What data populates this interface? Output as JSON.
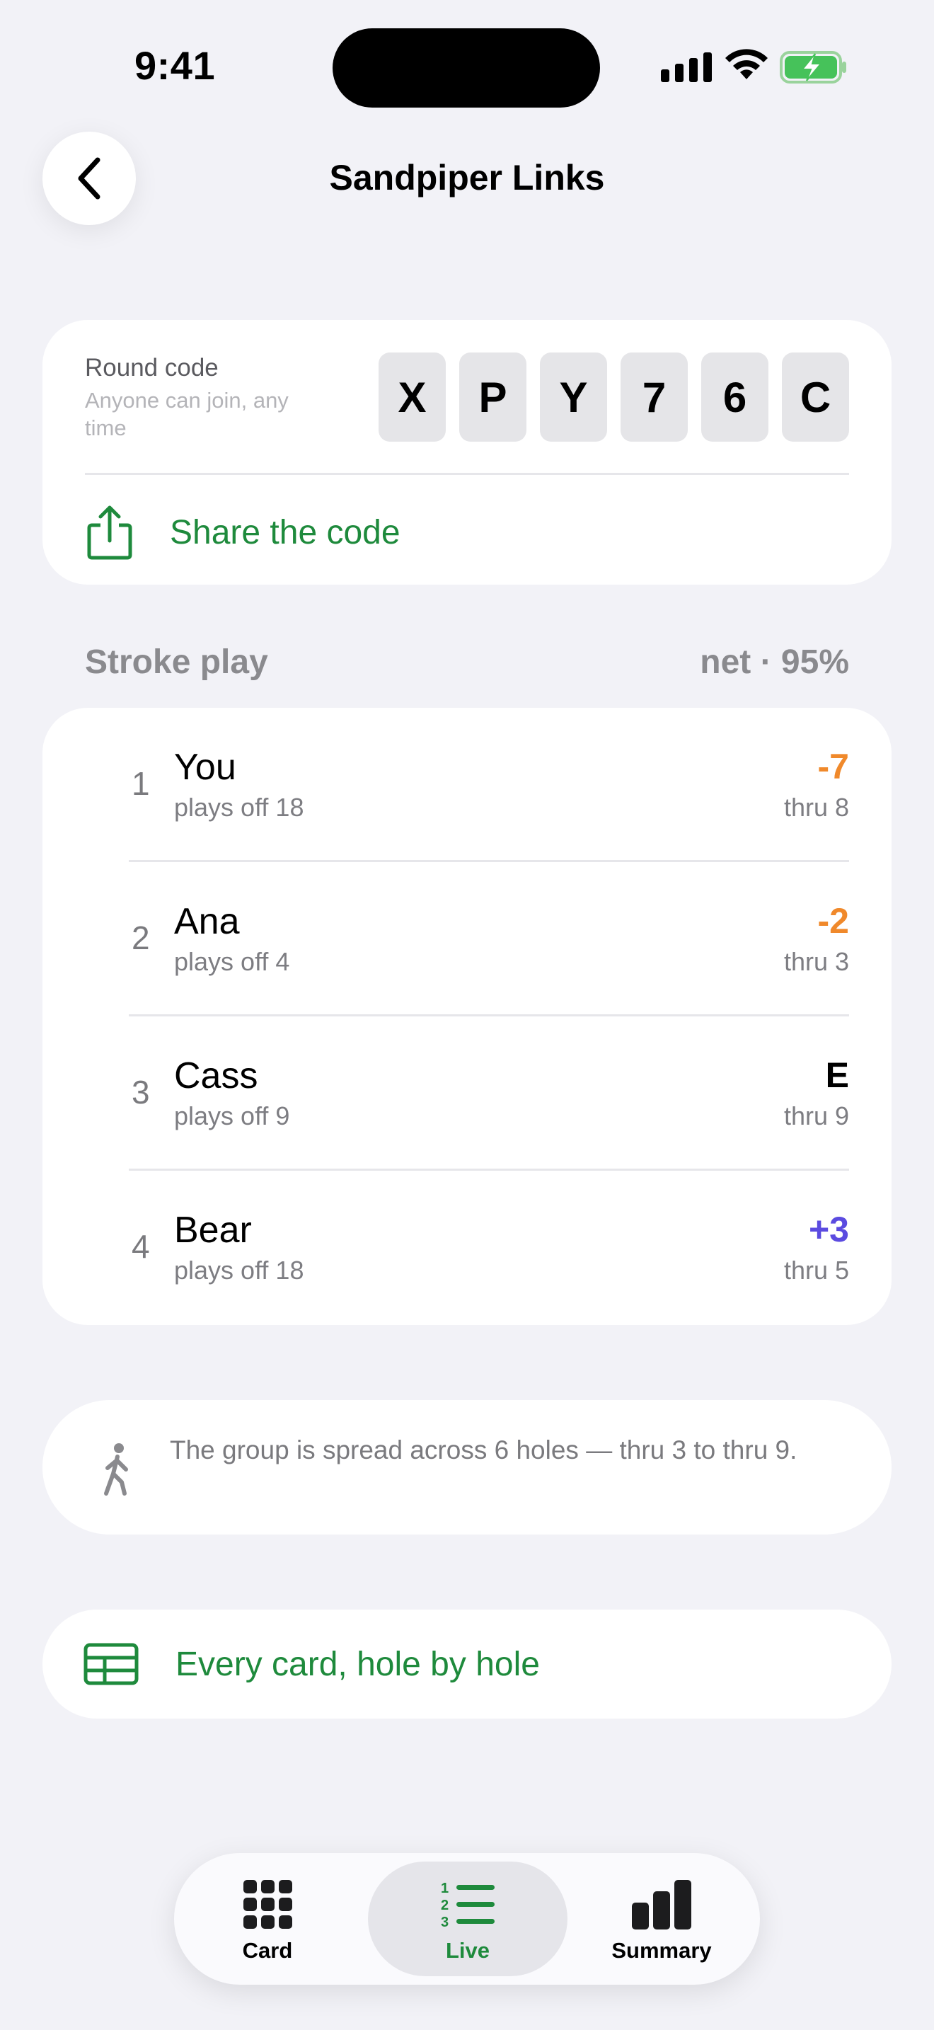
{
  "status_bar": {
    "time": "9:41"
  },
  "nav": {
    "title": "Sandpiper Links"
  },
  "round_code": {
    "label": "Round code",
    "sublabel": "Anyone can join, any time",
    "characters": [
      "X",
      "P",
      "Y",
      "7",
      "6",
      "C"
    ],
    "share_label": "Share the code"
  },
  "leaderboard": {
    "format": "Stroke play",
    "scoring": "net · 95%",
    "players": [
      {
        "rank": "1",
        "name": "You",
        "handicap": "plays off 18",
        "score": "-7",
        "thru": "thru 8",
        "score_color": "#f0892b"
      },
      {
        "rank": "2",
        "name": "Ana",
        "handicap": "plays off 4",
        "score": "-2",
        "thru": "thru 3",
        "score_color": "#f0892b"
      },
      {
        "rank": "3",
        "name": "Cass",
        "handicap": "plays off 9",
        "score": "E",
        "thru": "thru 9",
        "score_color": "#000000"
      },
      {
        "rank": "4",
        "name": "Bear",
        "handicap": "plays off 18",
        "score": "+3",
        "thru": "thru 5",
        "score_color": "#5b4be0"
      }
    ]
  },
  "info": {
    "text": "The group is spread across 6 holes — thru 3 to thru 9.",
    "icon": "walking-person-icon"
  },
  "every_card": {
    "label": "Every card, hole by hole",
    "icon": "table-grid-icon"
  },
  "tabs": [
    {
      "label": "Card",
      "icon": "grid-icon",
      "selected": false
    },
    {
      "label": "Live",
      "icon": "numbered-list-icon",
      "selected": true
    },
    {
      "label": "Summary",
      "icon": "bar-chart-icon",
      "selected": false
    }
  ],
  "colors": {
    "accent_green": "#1e8a3c",
    "under_par": "#f0892b",
    "over_par": "#5b4be0",
    "background": "#f2f2f7"
  }
}
